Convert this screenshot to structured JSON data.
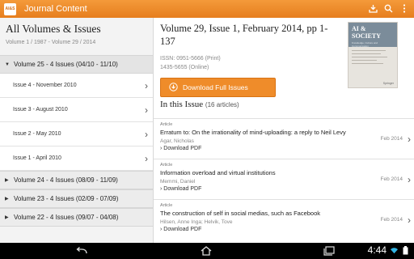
{
  "app": {
    "title": "Journal Content",
    "icon_text": "AI&S"
  },
  "sidebar": {
    "title": "All Volumes & Issues",
    "range": "Volume 1 / 1987 - Volume 29 / 2014",
    "expanded_volume": {
      "label": "Volume 25 - 4 Issues (04/10  -  11/10)"
    },
    "issues": [
      {
        "label": "Issue 4 - November 2010"
      },
      {
        "label": "Issue 3 - August 2010"
      },
      {
        "label": "Issue 2 - May 2010"
      },
      {
        "label": "Issue 1 - April 2010"
      }
    ],
    "volumes": [
      {
        "label": "Volume 24 - 4 Issues (08/09  -  11/09)"
      },
      {
        "label": "Volume 23 - 4 Issues (02/09  -  07/09)"
      },
      {
        "label": "Volume 22 - 4 Issues (09/07  -  04/08)"
      }
    ]
  },
  "main": {
    "volume_title": "Volume 29, Issue 1, February 2014, pp 1-137",
    "issn_print": "ISSN: 0951-5666 (Print)",
    "issn_online": "1435-5655 (Online)",
    "download_label": "Download Full Issues",
    "section_title": "In this Issue",
    "section_count": "(16 articles)",
    "cover": {
      "title": "AI & SOCIETY",
      "subtitle": "Knowledge, Culture and Communication",
      "publisher": "Springer"
    },
    "articles": [
      {
        "type": "Article",
        "title": "Erratum to: On the irrationality of mind-uploading: a reply to Neil Levy",
        "authors": "Agar, Nicholas",
        "date": "Feb 2014",
        "download": "Download PDF"
      },
      {
        "type": "Article",
        "title": "Information overload and virtual institutions",
        "authors": "Memmi, Daniel",
        "date": "Feb 2014",
        "download": "Download PDF"
      },
      {
        "type": "Article",
        "title": "The construction of self in social medias, such as Facebook",
        "authors": "Hilsen, Anne Inga; Helvik, Tove",
        "date": "Feb 2014",
        "download": "Download PDF"
      }
    ]
  },
  "system": {
    "time": "4:44"
  },
  "colors": {
    "accent": "#ef8c2a",
    "actionbar": "#e67e1e"
  }
}
